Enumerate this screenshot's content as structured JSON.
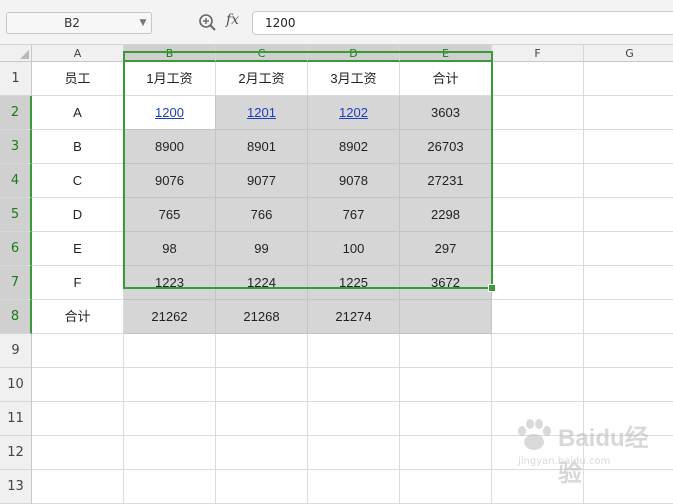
{
  "formula_bar": {
    "name_box": "B2",
    "fx_label": "fx",
    "value": "1200"
  },
  "columns": [
    "A",
    "B",
    "C",
    "D",
    "E",
    "F",
    "G"
  ],
  "rows": [
    "1",
    "2",
    "3",
    "4",
    "5",
    "6",
    "7",
    "8",
    "9",
    "10",
    "11",
    "12",
    "13"
  ],
  "sheet": {
    "header_row": [
      "员工",
      "1月工资",
      "2月工资",
      "3月工资",
      "合计"
    ],
    "data_rows": [
      [
        "A",
        "1200",
        "1201",
        "1202",
        "3603"
      ],
      [
        "B",
        "8900",
        "8901",
        "8902",
        "26703"
      ],
      [
        "C",
        "9076",
        "9077",
        "9078",
        "27231"
      ],
      [
        "D",
        "765",
        "766",
        "767",
        "2298"
      ],
      [
        "E",
        "98",
        "99",
        "100",
        "297"
      ],
      [
        "F",
        "1223",
        "1224",
        "1225",
        "3672"
      ],
      [
        "合计",
        "21262",
        "21268",
        "21274",
        ""
      ]
    ]
  },
  "selection": {
    "active_cell": "B2",
    "range": "B2:E8"
  },
  "colors": {
    "selection_border": "#3a9a3a",
    "hyperlink": "#1f3fb8",
    "selection_fill": "#d6d6d6"
  },
  "watermark": {
    "text": "Baidu经验",
    "sub": "jingyan.baidu.com"
  }
}
